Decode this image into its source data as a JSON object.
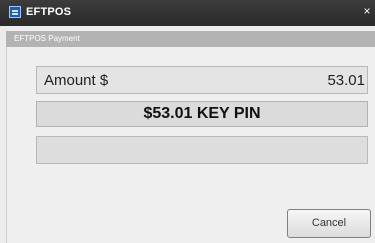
{
  "window": {
    "title": "EFTPOS",
    "close_glyph": "×",
    "icon": "app-icon"
  },
  "dialog": {
    "subtitle": "EFTPOS Payment"
  },
  "amount": {
    "label": "Amount $",
    "value": "53.01"
  },
  "message": {
    "text": "$53.01 KEY PIN"
  },
  "status": {
    "text": ""
  },
  "buttons": {
    "cancel_label": "Cancel"
  }
}
